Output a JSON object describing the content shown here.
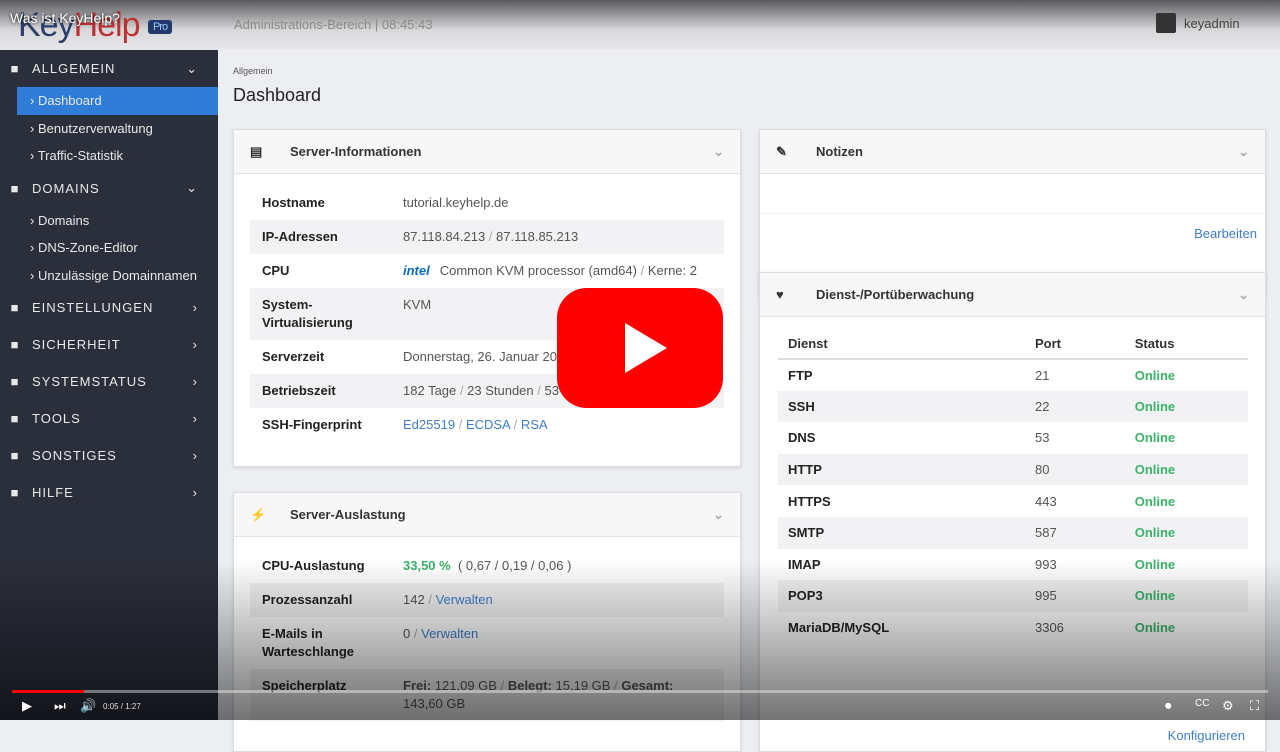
{
  "video": {
    "title": "Was ist KeyHelp?",
    "time": "0:05 / 1:27",
    "progress": 0.057
  },
  "header": {
    "logo": "KeyHelp",
    "logo_badge": "Pro",
    "admin_text": "Administrations-Bereich | 08:45:43",
    "user": "keyadmin"
  },
  "sidebar": [
    {
      "label": "ALLGEMEIN",
      "icon": "monitor-icon",
      "expanded": true,
      "items": [
        "Dashboard",
        "Benutzerverwaltung",
        "Traffic-Statistik"
      ],
      "active": "Dashboard"
    },
    {
      "label": "DOMAINS",
      "icon": "globe-icon",
      "expanded": true,
      "items": [
        "Domains",
        "DNS-Zone-Editor",
        "Unzulässige Domainnamen"
      ]
    },
    {
      "label": "EINSTELLUNGEN",
      "icon": "sliders-icon"
    },
    {
      "label": "SICHERHEIT",
      "icon": "shield-icon"
    },
    {
      "label": "SYSTEMSTATUS",
      "icon": "status-icon"
    },
    {
      "label": "TOOLS",
      "icon": "tools-icon"
    },
    {
      "label": "SONSTIGES",
      "icon": "leaf-icon"
    },
    {
      "label": "HILFE",
      "icon": "help-icon"
    }
  ],
  "page": {
    "breadcrumb": "Allgemein",
    "title": "Dashboard"
  },
  "server_info": {
    "title": "Server-Informationen",
    "rows": [
      {
        "label": "Hostname",
        "value": "tutorial.keyhelp.de"
      },
      {
        "label": "IP-Adressen",
        "value": "87.118.84.213",
        "value2": "87.118.85.213"
      },
      {
        "label": "CPU",
        "value": "Common KVM processor (amd64)",
        "value2": "Kerne: 2",
        "logo": "intel"
      },
      {
        "label": "System-Virtualisierung",
        "value": "KVM"
      },
      {
        "label": "Serverzeit",
        "value": "Donnerstag, 26. Januar 202… …43 (Europe/Berlin)"
      },
      {
        "label": "Betriebszeit",
        "value": "182 Tage",
        "value2": "23 Stunden",
        "value3": "53 Minu…"
      },
      {
        "label": "SSH-Fingerprint",
        "links": [
          "Ed25519",
          "ECDSA",
          "RSA"
        ]
      }
    ]
  },
  "server_load": {
    "title": "Server-Auslastung",
    "rows": [
      {
        "label": "CPU-Auslastung",
        "percent": "33,50 %",
        "value": "( 0,67 / 0,19 / 0,06 )"
      },
      {
        "label": "Prozessanzahl",
        "value": "142",
        "link": "Verwalten"
      },
      {
        "label": "E-Mails in Warteschlange",
        "value": "0",
        "link": "Verwalten"
      },
      {
        "label": "Speicherplatz",
        "free_l": "Frei:",
        "free": "121,09 GB",
        "used_l": "Belegt:",
        "used": "15,19 GB",
        "total_l": "Gesamt:",
        "total": "143,60 GB"
      }
    ]
  },
  "notes": {
    "title": "Notizen",
    "edit": "Bearbeiten"
  },
  "services": {
    "title": "Dienst-/Portüberwachung",
    "headers": [
      "Dienst",
      "Port",
      "Status"
    ],
    "rows": [
      [
        "FTP",
        "21",
        "Online"
      ],
      [
        "SSH",
        "22",
        "Online"
      ],
      [
        "DNS",
        "53",
        "Online"
      ],
      [
        "HTTP",
        "80",
        "Online"
      ],
      [
        "HTTPS",
        "443",
        "Online"
      ],
      [
        "SMTP",
        "587",
        "Online"
      ],
      [
        "IMAP",
        "993",
        "Online"
      ],
      [
        "POP3",
        "995",
        "Online"
      ],
      [
        "MariaDB/MySQL",
        "3306",
        "Online"
      ]
    ],
    "configure": "Konfigurieren"
  },
  "colors": {
    "accent": "#2f7dd6",
    "online": "#3cb36b",
    "sidebar": "#2b2f3b",
    "youtube": "#ff0000"
  }
}
